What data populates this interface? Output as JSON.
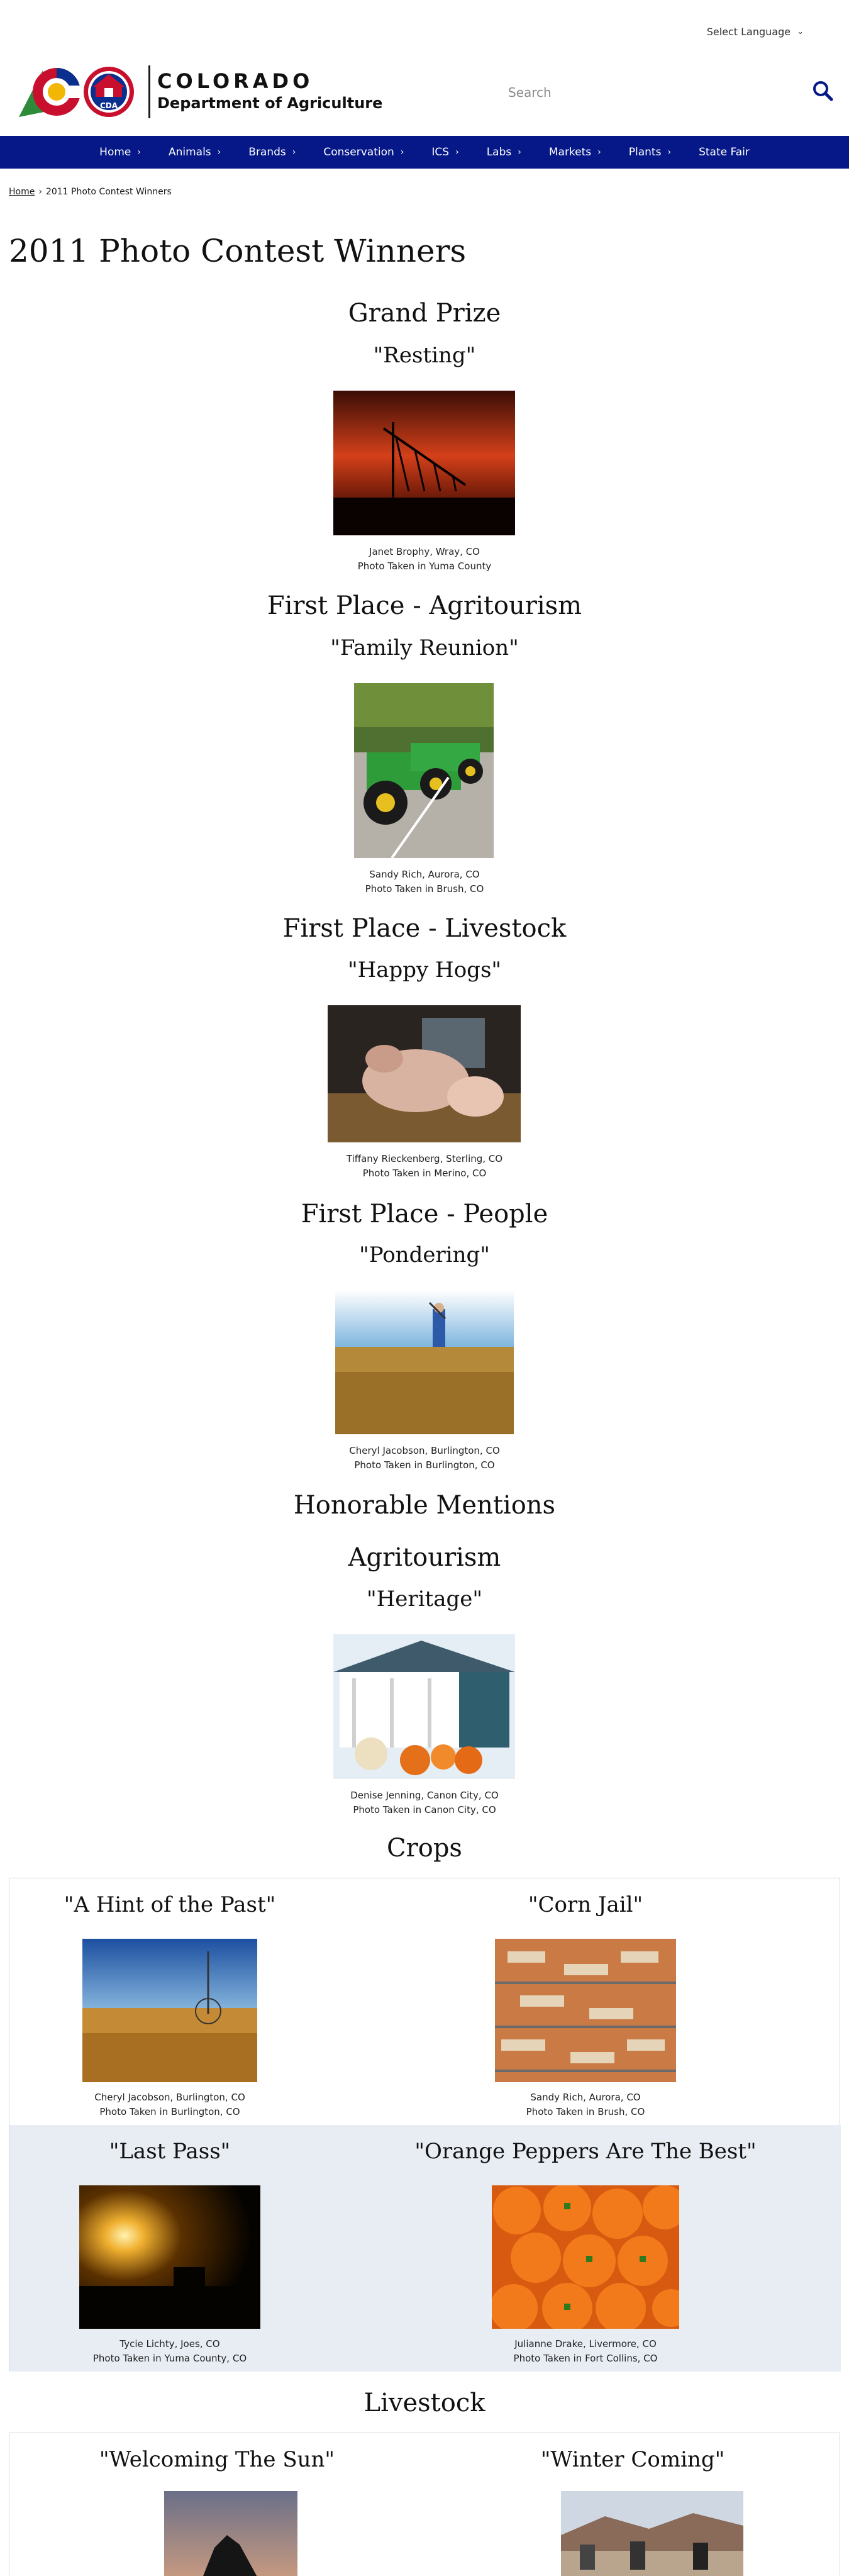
{
  "header": {
    "language_label": "Select Language",
    "brand_title": "COLORADO",
    "brand_subtitle": "Department of Agriculture",
    "logo_text": "CDA",
    "search_placeholder": "Search"
  },
  "nav": [
    {
      "label": "Home"
    },
    {
      "label": "Animals"
    },
    {
      "label": "Brands"
    },
    {
      "label": "Conservation"
    },
    {
      "label": "ICS"
    },
    {
      "label": "Labs"
    },
    {
      "label": "Markets"
    },
    {
      "label": "Plants"
    },
    {
      "label": "State Fair"
    }
  ],
  "breadcrumb": {
    "home": "Home",
    "separator": "›",
    "current": "2011 Photo Contest Winners"
  },
  "page_title": "2011 Photo Contest Winners",
  "winners": [
    {
      "category": "Grand Prize",
      "title": "\"Resting\"",
      "author": "Janet Brophy, Wray, CO",
      "location": "Photo Taken in Yuma County"
    },
    {
      "category": "First Place - Agritourism",
      "title": "\"Family Reunion\"",
      "author": "Sandy Rich, Aurora, CO",
      "location": "Photo Taken in Brush, CO"
    },
    {
      "category": "First Place - Livestock",
      "title": "\"Happy Hogs\"",
      "author": "Tiffany Rieckenberg, Sterling, CO",
      "location": "Photo Taken in Merino, CO"
    },
    {
      "category": "First Place - People",
      "title": "\"Pondering\"",
      "author": "Cheryl Jacobson, Burlington, CO",
      "location": "Photo Taken in Burlington, CO"
    }
  ],
  "honorable": {
    "heading": "Honorable Mentions",
    "agritourism": {
      "heading": "Agritourism",
      "title": "\"Heritage\"",
      "author": "Denise Jenning, Canon City, CO",
      "location": "Photo Taken in Canon City, CO"
    },
    "crops": {
      "heading": "Crops",
      "items": [
        {
          "title": "\"A Hint of the Past\"",
          "author": "Cheryl Jacobson, Burlington, CO",
          "location": "Photo Taken in Burlington, CO"
        },
        {
          "title": "\"Corn Jail\"",
          "author": "Sandy Rich, Aurora, CO",
          "location": "Photo Taken in Brush, CO"
        },
        {
          "title": "\"Last Pass\"",
          "author": "Tycie Lichty, Joes, CO",
          "location": "Photo Taken in Yuma County, CO"
        },
        {
          "title": "\"Orange Peppers Are The Best\"",
          "author": "Julianne Drake, Livermore, CO",
          "location": "Photo Taken in Fort Collins, CO"
        }
      ]
    },
    "livestock": {
      "heading": "Livestock",
      "items": [
        {
          "title": "\"Welcoming The Sun\""
        },
        {
          "title": "\"Winter Coming\""
        }
      ]
    }
  },
  "colors": {
    "nav_bg": "#061887",
    "grid_shade": "#e8edf4",
    "logo_red": "#c8102e",
    "logo_blue": "#0b2f8f",
    "logo_gold": "#f2b705"
  }
}
